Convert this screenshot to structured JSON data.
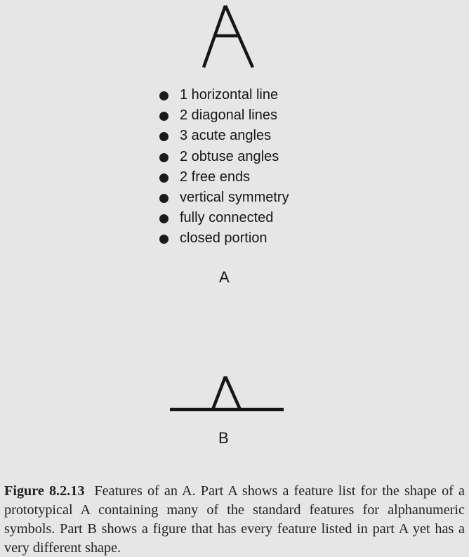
{
  "figure_a": {
    "glyph": "A",
    "features": [
      "1 horizontal line",
      "2 diagonal lines",
      "3 acute angles",
      "2 obtuse angles",
      "2 free ends",
      "vertical symmetry",
      "fully connected",
      "closed portion"
    ],
    "part_label": "A"
  },
  "figure_b": {
    "part_label": "B"
  },
  "caption": {
    "label": "Figure 8.2.13",
    "text": "Features of an A. Part A shows a feature list for the shape of a prototypical A containing many of the standard features for alphanumeric symbols. Part B shows a figure that has every feature listed in part A yet has a very different shape."
  }
}
